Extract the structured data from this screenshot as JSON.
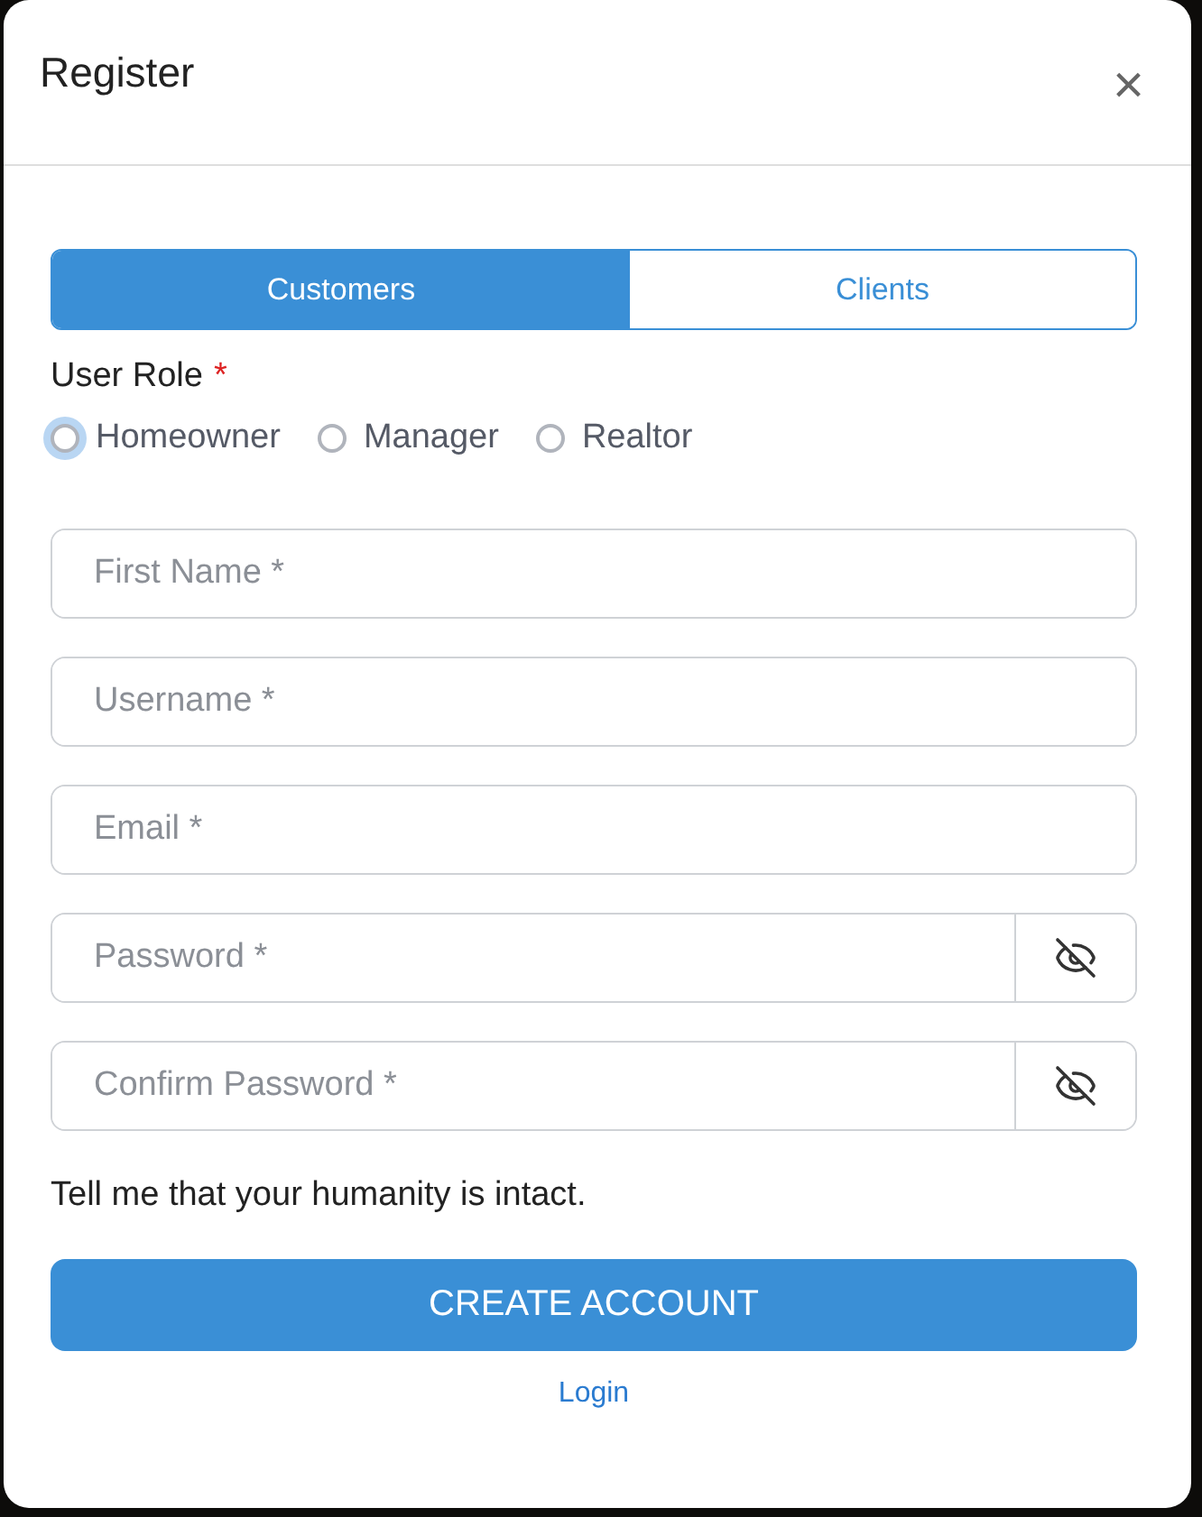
{
  "dialog": {
    "title": "Register",
    "close": "×"
  },
  "tabs": [
    {
      "label": "Customers",
      "selected": true
    },
    {
      "label": "Clients",
      "selected": false
    }
  ],
  "role": {
    "label": "User Role",
    "required_mark": "*",
    "options": [
      {
        "label": "Homeowner",
        "selected": false,
        "focused": true
      },
      {
        "label": "Manager",
        "selected": false,
        "focused": false
      },
      {
        "label": "Realtor",
        "selected": false,
        "focused": false
      }
    ]
  },
  "fields": [
    {
      "kind": "text",
      "placeholder": "First Name *"
    },
    {
      "kind": "text",
      "placeholder": "Username *"
    },
    {
      "kind": "text",
      "placeholder": "Email *"
    },
    {
      "kind": "password",
      "placeholder": "Password *"
    },
    {
      "kind": "password",
      "placeholder": "Confirm Password *"
    }
  ],
  "captcha_prompt": "Tell me that your humanity is intact.",
  "submit": "CREATE ACCOUNT",
  "login_link": "Login"
}
